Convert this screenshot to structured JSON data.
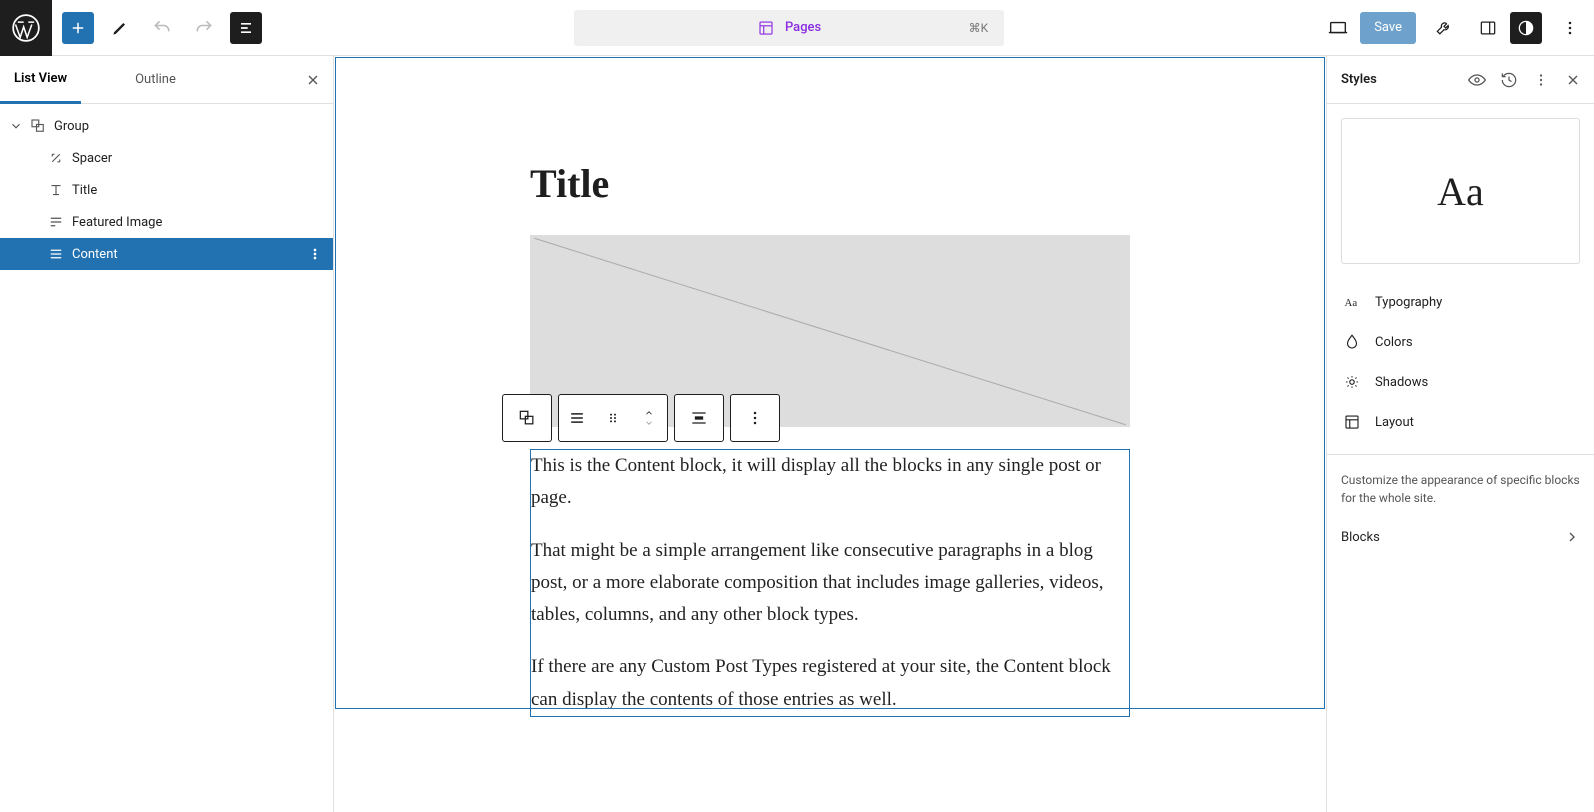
{
  "topbar": {
    "center_label": "Pages",
    "shortcut": "⌘K",
    "save_label": "Save"
  },
  "left_panel": {
    "tabs": {
      "list_view": "List View",
      "outline": "Outline"
    },
    "tree": {
      "group": "Group",
      "spacer": "Spacer",
      "title": "Title",
      "featured_image": "Featured Image",
      "content": "Content"
    }
  },
  "canvas": {
    "title": "Title",
    "paragraphs": [
      "This is the Content block, it will display all the blocks in any single post or page.",
      "That might be a simple arrangement like consecutive paragraphs in a blog post, or a more elaborate composition that includes image galleries, videos, tables, columns, and any other block types.",
      "If there are any Custom Post Types registered at your site, the Content block can display the contents of those entries as well."
    ]
  },
  "right_panel": {
    "title": "Styles",
    "preview": "Aa",
    "items": {
      "typography": "Typography",
      "colors": "Colors",
      "shadows": "Shadows",
      "layout": "Layout"
    },
    "description": "Customize the appearance of specific blocks for the whole site.",
    "blocks_label": "Blocks"
  }
}
